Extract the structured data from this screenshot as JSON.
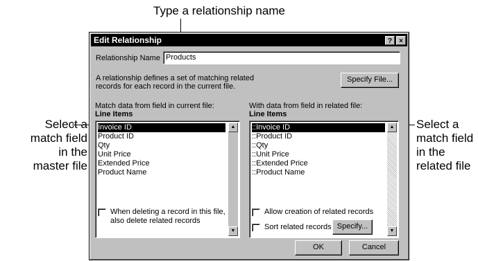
{
  "callouts": {
    "top": "Type a relationship name",
    "left": "Select a match field in the master file",
    "left_lines": [
      "Select a",
      "match field",
      "in the",
      "master file"
    ],
    "right_lines": [
      "Select a",
      "match field",
      "in the",
      "related file"
    ]
  },
  "dialog": {
    "title": "Edit Relationship",
    "help_button": "?",
    "close_button": "×",
    "name_label": "Relationship Name",
    "name_value": "Products",
    "description_line1": "A relationship defines a set of matching related",
    "description_line2": "records for each record in the current file.",
    "specify_file_button": "Specify File...",
    "left_list_label": "Match data from field in current file:",
    "left_list_title": "Line Items",
    "left_items": [
      "Invoice ID",
      "Product ID",
      "Qty",
      "Unit Price",
      "Extended Price",
      "Product Name"
    ],
    "right_list_label": "With data from field in related file:",
    "right_list_title": "Line Items",
    "right_items": [
      "::Invoice ID",
      "::Product ID",
      "::Qty",
      "::Unit Price",
      "::Extended Price",
      "::Product Name"
    ],
    "delete_checkbox_line1": "When deleting a record in this file,",
    "delete_checkbox_line2": "also delete related records",
    "allow_creation_checkbox": "Allow creation of related records",
    "sort_checkbox": "Sort related records",
    "specify_button": "Specify...",
    "ok_button": "OK",
    "cancel_button": "Cancel"
  }
}
